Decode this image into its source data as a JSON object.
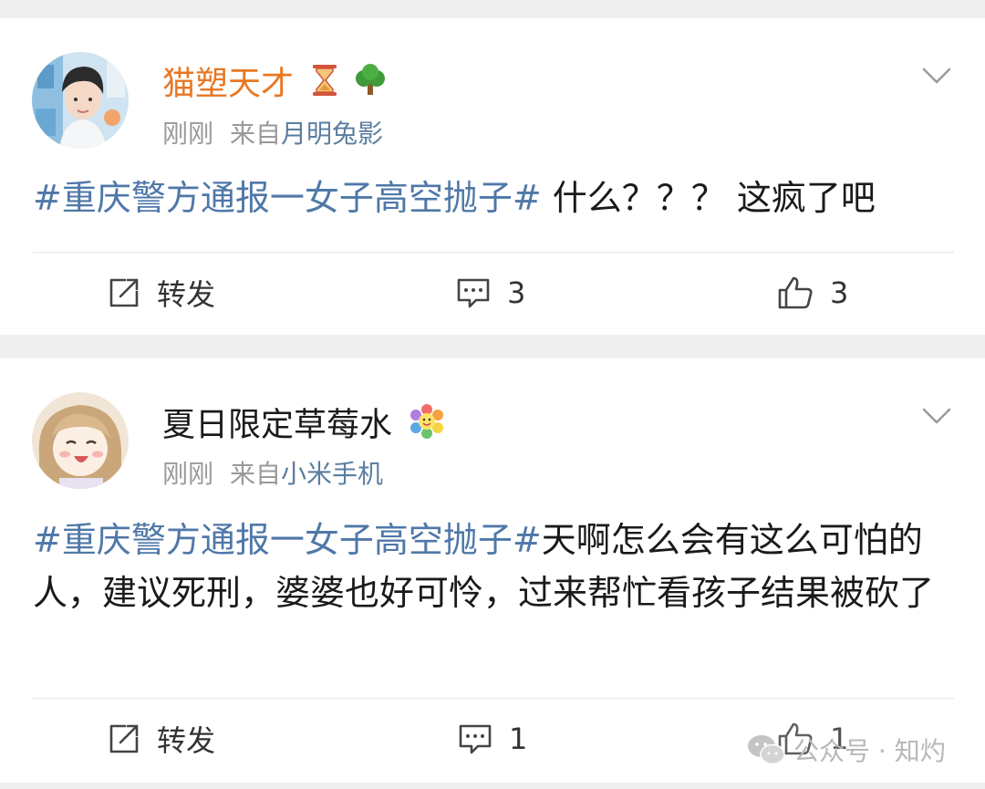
{
  "posts": [
    {
      "username": "猫塑天才",
      "username_color": "#e87722",
      "badges": [
        "hourglass-icon",
        "tree-icon"
      ],
      "time": "刚刚",
      "source_prefix": "来自",
      "source": "月明兔影",
      "hashtag": "#重庆警方通报一女子高空抛子#",
      "text": " 什么？？？ 这疯了吧",
      "actions": {
        "repost_label": "转发",
        "comment_count": "3",
        "like_count": "3"
      }
    },
    {
      "username": "夏日限定草莓水",
      "username_color": "#1a1a1a",
      "badges": [
        "flower-icon"
      ],
      "time": "刚刚",
      "source_prefix": "来自",
      "source": "小米手机",
      "hashtag": "#重庆警方通报一女子高空抛子#",
      "text": "天啊怎么会有这么可怕的人，建议死刑，婆婆也好可怜，过来帮忙看孩子结果被砍了",
      "actions": {
        "repost_label": "转发",
        "comment_count": "1",
        "like_count": "1"
      }
    }
  ],
  "watermark": {
    "text": "公众号 · 知灼",
    "icon": "wechat-icon"
  },
  "colors": {
    "hashtag": "#4f78a8",
    "source_link": "#5a7ea0",
    "meta_gray": "#999999",
    "page_background": "#efefef"
  }
}
